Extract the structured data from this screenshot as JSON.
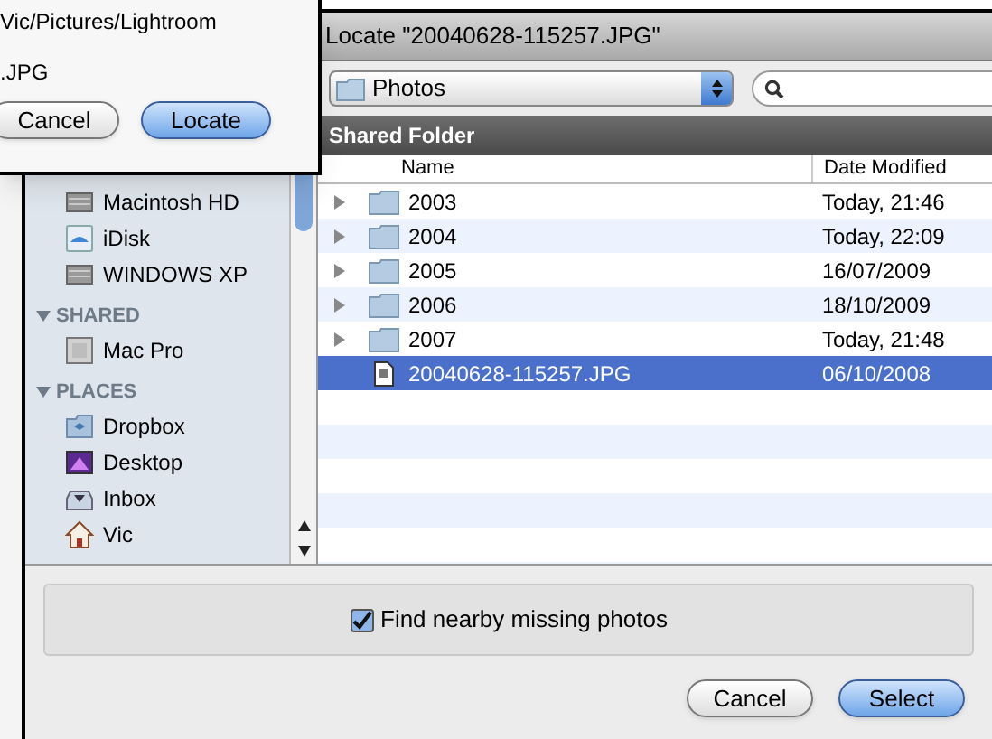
{
  "back_dialog": {
    "path": "Vic/Pictures/Lightroom",
    "file": ".JPG",
    "buttons": [
      {
        "label": "Cancel",
        "default": false
      },
      {
        "label": "Locate",
        "default": true
      }
    ]
  },
  "window": {
    "title": "Locate \"20040628-115257.JPG\""
  },
  "location_popup": {
    "value": "Photos"
  },
  "sidebar": {
    "sections": [
      {
        "items": [
          {
            "kind": "drive",
            "label": "Macintosh HD"
          },
          {
            "kind": "idisk",
            "label": "iDisk"
          },
          {
            "kind": "drive",
            "label": "WINDOWS XP"
          }
        ]
      },
      {
        "heading": "SHARED",
        "expanded": true,
        "items": [
          {
            "kind": "computer",
            "label": "Mac Pro"
          }
        ]
      },
      {
        "heading": "PLACES",
        "expanded": true,
        "items": [
          {
            "kind": "dropbox",
            "label": "Dropbox"
          },
          {
            "kind": "desktop",
            "label": "Desktop"
          },
          {
            "kind": "inbox",
            "label": "Inbox"
          },
          {
            "kind": "home",
            "label": "Vic"
          }
        ]
      }
    ]
  },
  "browser": {
    "header": "Shared Folder",
    "columns": [
      "Name",
      "Date Modified"
    ],
    "rows": [
      {
        "kind": "folder",
        "name": "2003",
        "date": "Today, 21:46",
        "selected": false
      },
      {
        "kind": "folder",
        "name": "2004",
        "date": "Today, 22:09",
        "selected": false
      },
      {
        "kind": "folder",
        "name": "2005",
        "date": "16/07/2009",
        "selected": false
      },
      {
        "kind": "folder",
        "name": "2006",
        "date": "18/10/2009",
        "selected": false
      },
      {
        "kind": "folder",
        "name": "2007",
        "date": "Today, 21:48",
        "selected": false
      },
      {
        "kind": "file",
        "name": "20040628-115257.JPG",
        "date": "06/10/2008",
        "selected": true
      }
    ]
  },
  "option": {
    "label": "Find nearby missing photos",
    "checked": true
  },
  "buttons": [
    {
      "label": "Cancel",
      "default": false
    },
    {
      "label": "Select",
      "default": true
    }
  ]
}
